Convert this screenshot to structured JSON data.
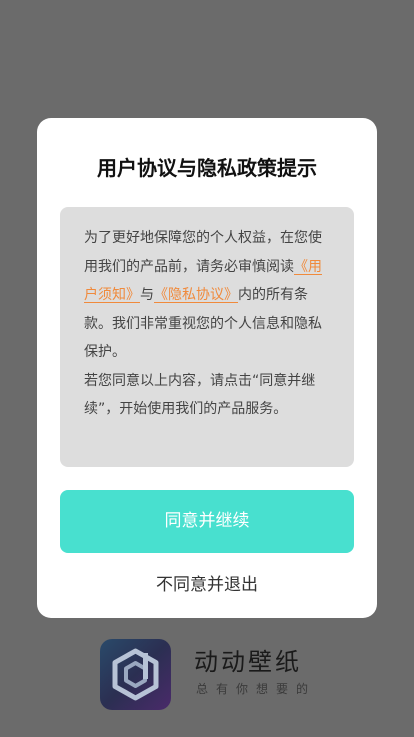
{
  "dialog": {
    "title": "用户协议与隐私政策提示",
    "body": {
      "intro": "为了更好地保障您的个人权益，在您使用我们的产品前，请务必审慎阅读",
      "user_agreement_link": "《用户须知》",
      "conjunction": "与",
      "privacy_link": "《隐私协议》",
      "after_links": "内的所有条款。我们非常重视您的个人信息和隐私保护。",
      "consent": "若您同意以上内容，请点击“同意并继续”，开始使用我们的产品服务。"
    },
    "agree_label": "同意并继续",
    "decline_label": "不同意并退出"
  },
  "branding": {
    "logo_icon": "app-logo-d-hexagon",
    "app_name": "动动壁纸",
    "slogan": "总有你想要的"
  },
  "colors": {
    "overlay": "#6b6b6b",
    "accent": "#48e0cf",
    "link": "#f08a3c",
    "terms_background": "#dddddd"
  }
}
